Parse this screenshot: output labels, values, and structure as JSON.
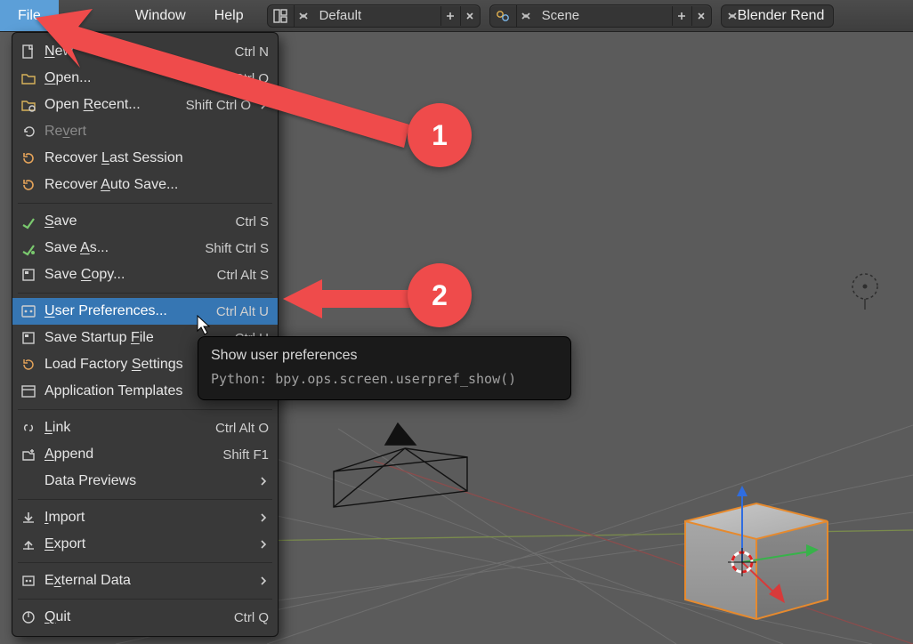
{
  "menubar": {
    "file": "File",
    "window": "Window",
    "help": "Help",
    "layout_selector": {
      "label": "Default",
      "plus": "+",
      "close": "×"
    },
    "scene_selector": {
      "label": "Scene",
      "plus": "+",
      "close": "×"
    },
    "render_button": {
      "label": "Blender Rend"
    }
  },
  "file_menu": {
    "new": {
      "label": "New",
      "mnemonic_index": 0,
      "shortcut": "Ctrl N"
    },
    "open": {
      "label": "Open...",
      "mnemonic_index": 0,
      "shortcut": "Ctrl O"
    },
    "open_recent": {
      "label": "Open Recent...",
      "mnemonic_index": 5,
      "shortcut": "Shift Ctrl O",
      "submenu": true
    },
    "revert": {
      "label": "Revert",
      "mnemonic_index": 2,
      "disabled": true
    },
    "recover_last": {
      "label": "Recover Last Session",
      "mnemonic_index": 8
    },
    "recover_auto": {
      "label": "Recover Auto Save...",
      "mnemonic_index": 8
    },
    "save": {
      "label": "Save",
      "mnemonic_index": 0,
      "shortcut": "Ctrl S"
    },
    "save_as": {
      "label": "Save As...",
      "mnemonic_index": 5,
      "shortcut": "Shift Ctrl S"
    },
    "save_copy": {
      "label": "Save Copy...",
      "mnemonic_index": 5,
      "shortcut": "Ctrl Alt S"
    },
    "user_prefs": {
      "label": "User Preferences...",
      "mnemonic_index": 0,
      "shortcut": "Ctrl Alt U",
      "highlighted": true
    },
    "save_startup": {
      "label": "Save Startup File",
      "mnemonic_index": 13,
      "shortcut": "Ctrl U"
    },
    "load_factory": {
      "label": "Load Factory Settings",
      "mnemonic_index": 13
    },
    "app_templates": {
      "label": "Application Templates",
      "submenu": true
    },
    "link": {
      "label": "Link",
      "mnemonic_index": 0,
      "shortcut": "Ctrl Alt O"
    },
    "append": {
      "label": "Append",
      "mnemonic_index": 0,
      "shortcut": "Shift F1"
    },
    "data_previews": {
      "label": "Data Previews",
      "submenu": true
    },
    "import": {
      "label": "Import",
      "mnemonic_index": 0,
      "submenu": true
    },
    "export": {
      "label": "Export",
      "mnemonic_index": 0,
      "submenu": true
    },
    "external_data": {
      "label": "External Data",
      "mnemonic_index": 1,
      "submenu": true
    },
    "quit": {
      "label": "Quit",
      "mnemonic_index": 0,
      "shortcut": "Ctrl Q"
    }
  },
  "tooltip": {
    "title": "Show user preferences",
    "python": "Python: bpy.ops.screen.userpref_show()"
  },
  "callouts": {
    "c1": "1",
    "c2": "2"
  }
}
